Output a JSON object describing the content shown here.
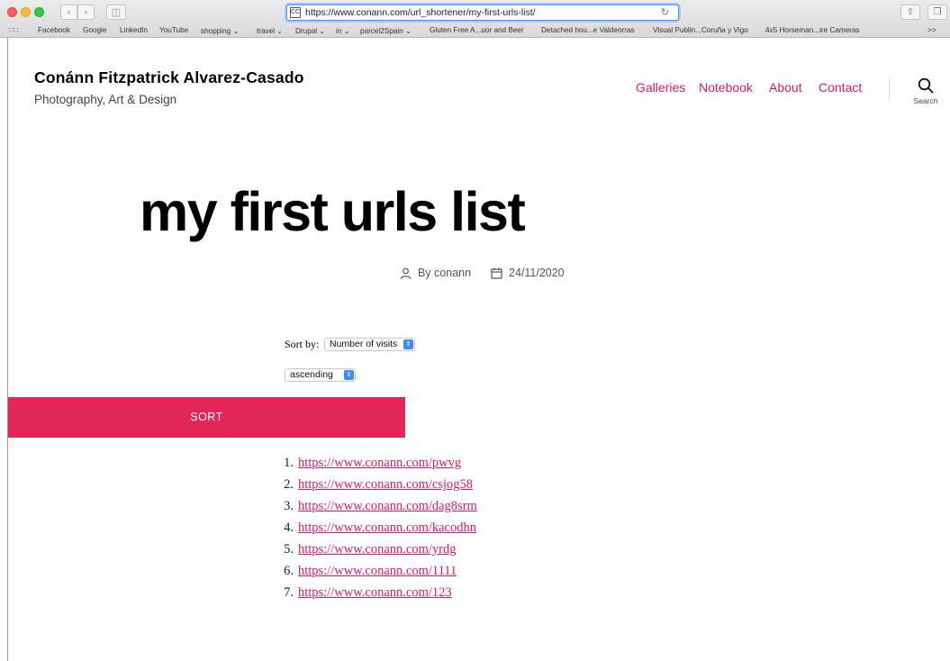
{
  "browser": {
    "url": "https://www.conann.com/url_shortener/my-first-urls-list/",
    "site_icon": "CC",
    "reload_icon": "reload-icon",
    "bookmarks": [
      "Facebook",
      "Google",
      "LinkedIn",
      "YouTube",
      "shopping ⌄",
      "travel ⌄",
      "Drupal ⌄",
      "in ⌄",
      "parcel2Spain ⌄",
      "Gluten Free A...uor and Beer",
      "Detached hou...e Valdeorras",
      "Visual Publin...Coruña y Vigo",
      "4x5 Horseman...ire Cameras"
    ],
    "bookmarks_more": ">>"
  },
  "site": {
    "title": "Conánn Fitzpatrick Alvarez-Casado",
    "description": "Photography, Art & Design",
    "menu": [
      "Galleries",
      "Notebook",
      "About",
      "Contact"
    ],
    "search_label": "Search"
  },
  "entry": {
    "title": "my first urls list",
    "author": "By conann",
    "date": "24/11/2020"
  },
  "sort_form": {
    "label": "Sort by:",
    "field_value": "Number of visits",
    "order_value": "ascending",
    "button_label": "SORT"
  },
  "urls": [
    {
      "num": "1.",
      "url": "https://www.conann.com/pwvg"
    },
    {
      "num": "2.",
      "url": "https://www.conann.com/csjog58"
    },
    {
      "num": "3.",
      "url": "https://www.conann.com/dag8srm"
    },
    {
      "num": "4.",
      "url": "https://www.conann.com/kacodhn"
    },
    {
      "num": "5.",
      "url": "https://www.conann.com/yrdg"
    },
    {
      "num": "6.",
      "url": "https://www.conann.com/1111"
    },
    {
      "num": "7.",
      "url": "https://www.conann.com/123"
    }
  ],
  "colors": {
    "accent": "#e22658",
    "link": "#d81b60"
  }
}
